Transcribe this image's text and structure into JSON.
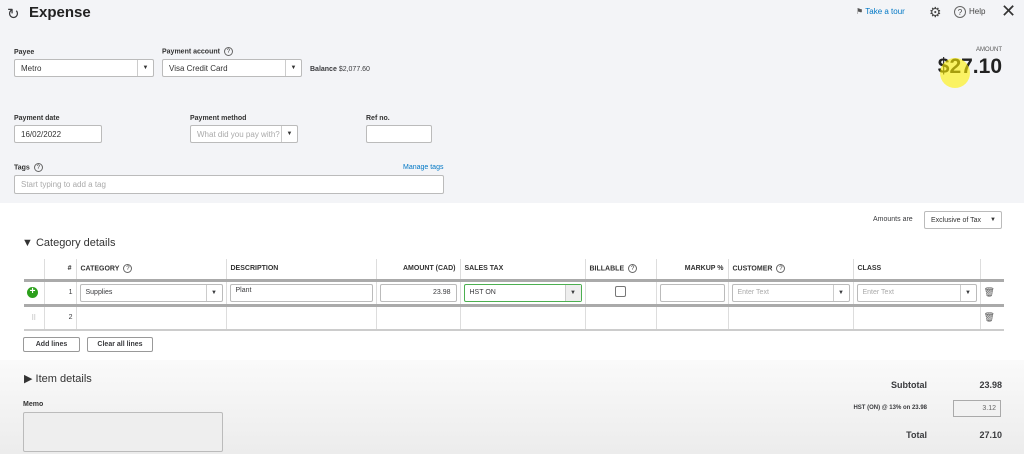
{
  "header": {
    "title": "Expense",
    "take_tour": "Take a tour",
    "help": "Help"
  },
  "amount": {
    "label": "AMOUNT",
    "value": "$27.10"
  },
  "payee": {
    "label": "Payee",
    "value": "Metro"
  },
  "payment_account": {
    "label": "Payment account",
    "value": "Visa Credit Card",
    "balance_label": "Balance",
    "balance": "$2,077.60"
  },
  "payment_date": {
    "label": "Payment date",
    "value": "16/02/2022"
  },
  "payment_method": {
    "label": "Payment method",
    "placeholder": "What did you pay with?"
  },
  "ref_no": {
    "label": "Ref no.",
    "value": ""
  },
  "tags": {
    "label": "Tags",
    "manage": "Manage tags",
    "placeholder": "Start typing to add a tag"
  },
  "amounts_are": {
    "label": "Amounts are",
    "value": "Exclusive of Tax"
  },
  "category_details": {
    "title": "Category details",
    "columns": [
      "#",
      "CATEGORY",
      "DESCRIPTION",
      "AMOUNT (CAD)",
      "SALES TAX",
      "BILLABLE",
      "MARKUP %",
      "CUSTOMER",
      "CLASS"
    ],
    "rows": [
      {
        "num": "1",
        "category": "Supplies",
        "description": "Plant",
        "amount": "23.98",
        "sales_tax": "HST ON",
        "customer_placeholder": "Enter Text",
        "class_placeholder": "Enter Text"
      },
      {
        "num": "2"
      }
    ],
    "add_lines": "Add lines",
    "clear_lines": "Clear all lines"
  },
  "item_details": {
    "title": "Item details"
  },
  "memo": {
    "label": "Memo"
  },
  "totals": {
    "subtotal_label": "Subtotal",
    "subtotal": "23.98",
    "tax_label": "HST (ON) @ 13% on 23.98",
    "tax": "3.12",
    "total_label": "Total",
    "total": "27.10"
  }
}
